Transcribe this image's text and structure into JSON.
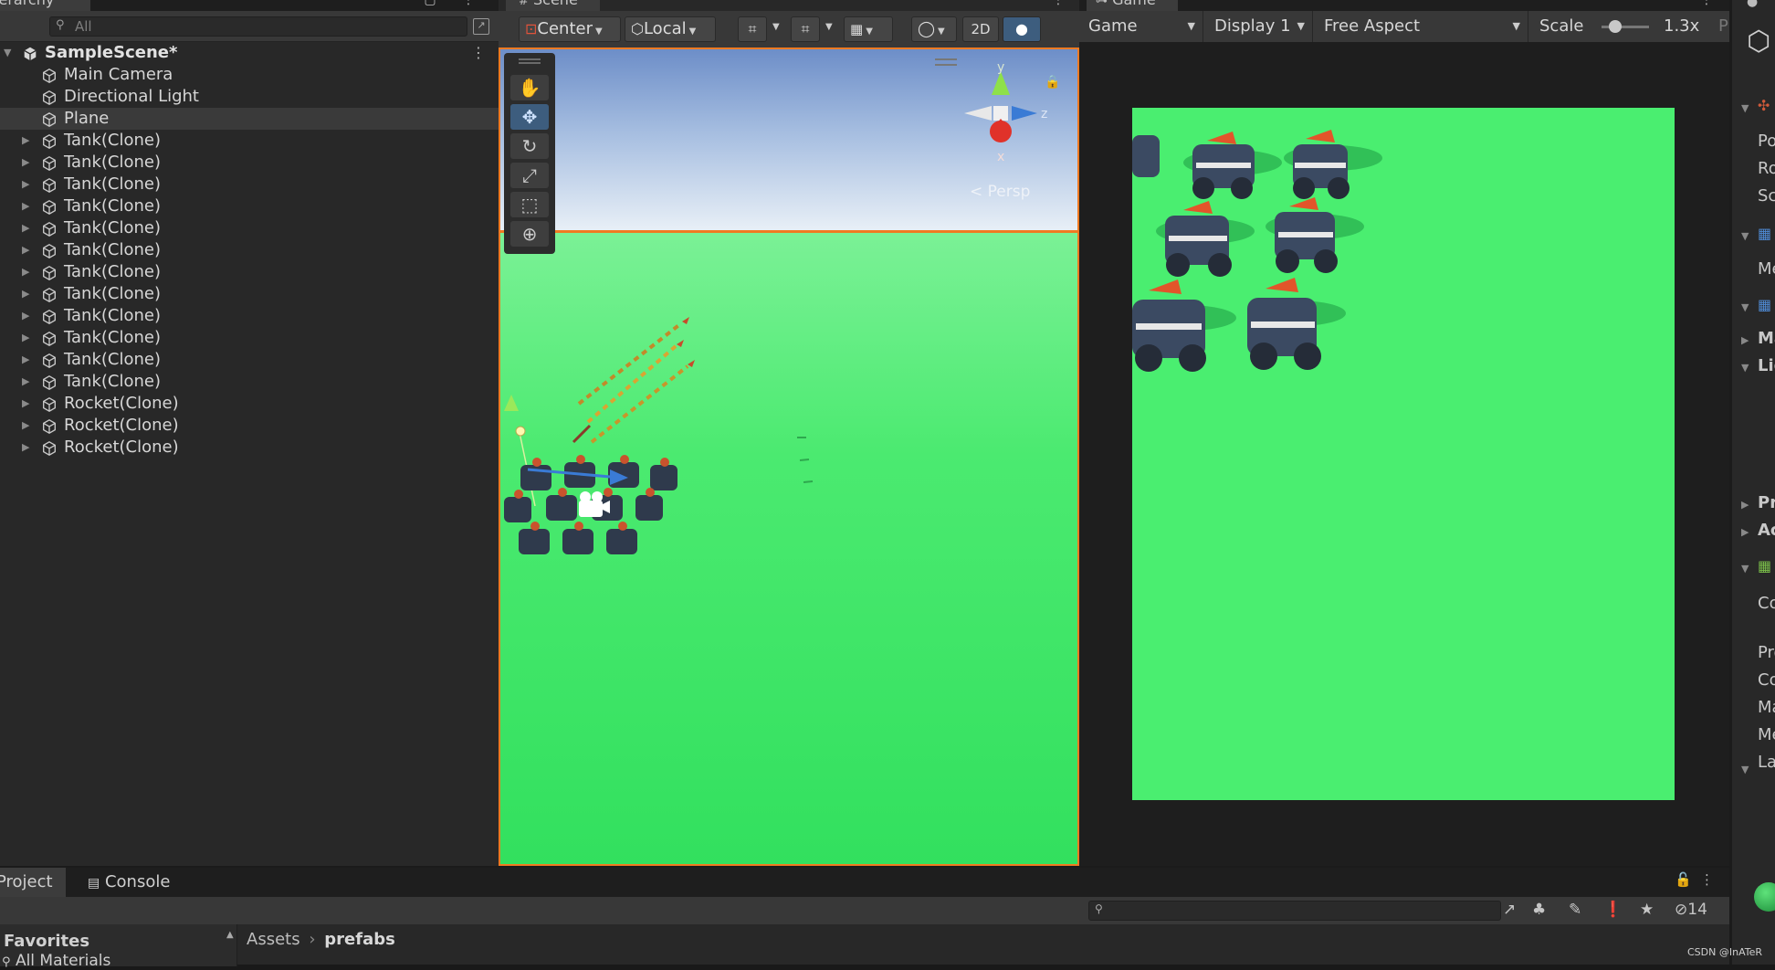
{
  "hierarchy": {
    "tab_label": "Hierarchy",
    "search_placeholder": "All",
    "scene_name": "SampleScene*",
    "items": [
      {
        "label": "Main Camera",
        "expandable": false
      },
      {
        "label": "Directional Light",
        "expandable": false
      },
      {
        "label": "Plane",
        "expandable": false,
        "selected": true
      },
      {
        "label": "Tank(Clone)",
        "expandable": true
      },
      {
        "label": "Tank(Clone)",
        "expandable": true
      },
      {
        "label": "Tank(Clone)",
        "expandable": true
      },
      {
        "label": "Tank(Clone)",
        "expandable": true
      },
      {
        "label": "Tank(Clone)",
        "expandable": true
      },
      {
        "label": "Tank(Clone)",
        "expandable": true
      },
      {
        "label": "Tank(Clone)",
        "expandable": true
      },
      {
        "label": "Tank(Clone)",
        "expandable": true
      },
      {
        "label": "Tank(Clone)",
        "expandable": true
      },
      {
        "label": "Tank(Clone)",
        "expandable": true
      },
      {
        "label": "Tank(Clone)",
        "expandable": true
      },
      {
        "label": "Tank(Clone)",
        "expandable": true
      },
      {
        "label": "Rocket(Clone)",
        "expandable": true
      },
      {
        "label": "Rocket(Clone)",
        "expandable": true
      },
      {
        "label": "Rocket(Clone)",
        "expandable": true
      }
    ]
  },
  "scene": {
    "tab_label": "Scene",
    "pivot_mode": "Center",
    "pivot_rotation": "Local",
    "mode_2d": "2D",
    "persp_label": "< Persp",
    "gizmo": {
      "y": "y",
      "z": "z",
      "x": "x"
    },
    "tools": [
      "hand-tool",
      "move-tool",
      "rotate-tool",
      "scale-tool",
      "rect-tool",
      "transform-tool"
    ],
    "active_tool": "move-tool"
  },
  "game": {
    "tab_label": "Game",
    "view_mode": "Game",
    "display": "Display 1",
    "aspect": "Free Aspect",
    "scale_label": "Scale",
    "scale_value": "1.3x",
    "next_label": "P"
  },
  "inspector": {
    "rows": [
      "Po",
      "Ro",
      "Sc",
      "Me",
      "Ma",
      "Lig",
      "Pr",
      "Ac",
      "Co",
      "Pro",
      "Co",
      "Ma",
      "Me",
      "La"
    ]
  },
  "bottom": {
    "tabs": [
      "Project",
      "Console"
    ],
    "favorites_label": "Favorites",
    "favorites_item": "All Materials",
    "breadcrumb_root": "Assets",
    "breadcrumb_current": "prefabs",
    "hidden_count": "14"
  },
  "watermark": "CSDN @InATeR",
  "colors": {
    "selection_outline": "#f07a22",
    "ground_green": "#4aee70",
    "active_tool_blue": "#3d5d7e"
  }
}
